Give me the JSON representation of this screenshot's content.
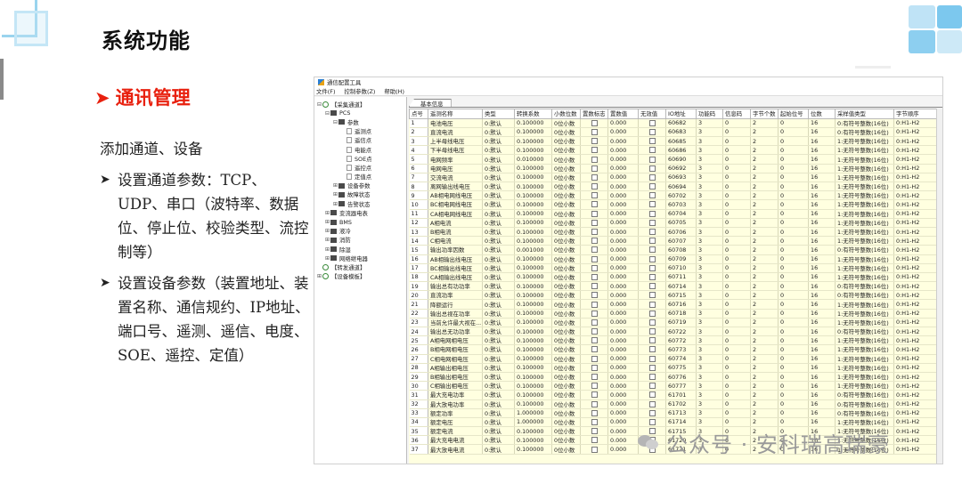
{
  "slide": {
    "title": "系统功能",
    "section_heading": "通讯管理",
    "intro": "添加通道、设备",
    "bullets": [
      "设置通道参数：TCP、UDP、串口（波特率、数据位、停止位、校验类型、流控制等）",
      "设置设备参数（装置地址、装置名称、通信规约、IP地址、端口号、遥测、遥信、电度、SOE、遥控、定值）"
    ],
    "watermark": "公众号 · 安科瑞高瑞豪"
  },
  "app": {
    "title": "通信配置工具",
    "menu": [
      "文件(F)",
      "控制参数(Z)",
      "帮助(H)"
    ],
    "tab_label": "基本信息",
    "tree": [
      {
        "label": "【采集通道】",
        "depth": 0,
        "toggle": "⊟",
        "icon": "gear"
      },
      {
        "label": "PCS",
        "depth": 1,
        "toggle": "⊟",
        "icon": "folder"
      },
      {
        "label": "参数",
        "depth": 2,
        "toggle": "⊟",
        "icon": "folder"
      },
      {
        "label": "遥测点",
        "depth": 3,
        "toggle": "",
        "icon": "leaf"
      },
      {
        "label": "遥信点",
        "depth": 3,
        "toggle": "",
        "icon": "leaf"
      },
      {
        "label": "电能点",
        "depth": 3,
        "toggle": "",
        "icon": "leaf"
      },
      {
        "label": "SOE点",
        "depth": 3,
        "toggle": "",
        "icon": "leaf"
      },
      {
        "label": "遥控点",
        "depth": 3,
        "toggle": "",
        "icon": "leaf"
      },
      {
        "label": "定值点",
        "depth": 3,
        "toggle": "",
        "icon": "leaf"
      },
      {
        "label": "设备参数",
        "depth": 2,
        "toggle": "⊞",
        "icon": "folder"
      },
      {
        "label": "故障状态",
        "depth": 2,
        "toggle": "⊞",
        "icon": "folder"
      },
      {
        "label": "告警状态",
        "depth": 2,
        "toggle": "⊞",
        "icon": "folder"
      },
      {
        "label": "变流器电表",
        "depth": 1,
        "toggle": "⊞",
        "icon": "folder"
      },
      {
        "label": "BMS",
        "depth": 1,
        "toggle": "⊞",
        "icon": "folder"
      },
      {
        "label": "液冷",
        "depth": 1,
        "toggle": "⊞",
        "icon": "folder"
      },
      {
        "label": "消防",
        "depth": 1,
        "toggle": "⊞",
        "icon": "folder"
      },
      {
        "label": "除湿",
        "depth": 1,
        "toggle": "⊞",
        "icon": "folder"
      },
      {
        "label": "网络继电器",
        "depth": 1,
        "toggle": "⊞",
        "icon": "folder"
      },
      {
        "label": "【转发通道】",
        "depth": 0,
        "toggle": "",
        "icon": "gear"
      },
      {
        "label": "【设备模板】",
        "depth": 0,
        "toggle": "⊞",
        "icon": "gear"
      }
    ],
    "columns": [
      "点号",
      "遥测名称",
      "类型",
      "转换系数",
      "小数位数",
      "置数标志",
      "置数值",
      "无效值",
      "IO地址",
      "功能码",
      "信息码",
      "字节个数",
      "起始位号",
      "位数",
      "采样值类型",
      "字节顺序"
    ],
    "rows": [
      [
        "1",
        "电池电压",
        "0:默认",
        "0.100000",
        "0位小数",
        "",
        "0.000",
        "",
        "60682",
        "3",
        "0",
        "2",
        "0",
        "16",
        "0:有符号整数(16位)",
        "0:H1-H2"
      ],
      [
        "2",
        "直流电流",
        "0:默认",
        "0.100000",
        "0位小数",
        "",
        "0.000",
        "",
        "60683",
        "3",
        "0",
        "2",
        "0",
        "16",
        "0:有符号整数(16位)",
        "0:H1-H2"
      ],
      [
        "3",
        "上半母线电压",
        "0:默认",
        "0.100000",
        "0位小数",
        "",
        "0.000",
        "",
        "60685",
        "3",
        "0",
        "2",
        "0",
        "16",
        "1:无符号整数(16位)",
        "0:H1-H2"
      ],
      [
        "4",
        "下半母线电压",
        "0:默认",
        "0.100000",
        "0位小数",
        "",
        "0.000",
        "",
        "60686",
        "3",
        "0",
        "2",
        "0",
        "16",
        "1:无符号整数(16位)",
        "0:H1-H2"
      ],
      [
        "5",
        "电网频率",
        "0:默认",
        "0.010000",
        "0位小数",
        "",
        "0.000",
        "",
        "60690",
        "3",
        "0",
        "2",
        "0",
        "16",
        "1:无符号整数(16位)",
        "0:H1-H2"
      ],
      [
        "6",
        "电网电压",
        "0:默认",
        "0.100000",
        "0位小数",
        "",
        "0.000",
        "",
        "60692",
        "3",
        "0",
        "2",
        "0",
        "16",
        "1:无符号整数(16位)",
        "0:H1-H2"
      ],
      [
        "7",
        "交流电流",
        "0:默认",
        "0.100000",
        "0位小数",
        "",
        "0.000",
        "",
        "60693",
        "3",
        "0",
        "2",
        "0",
        "16",
        "1:无符号整数(16位)",
        "0:H1-H2"
      ],
      [
        "8",
        "离网输出线电压",
        "0:默认",
        "0.100000",
        "0位小数",
        "",
        "0.000",
        "",
        "60694",
        "3",
        "0",
        "2",
        "0",
        "16",
        "1:无符号整数(16位)",
        "0:H1-H2"
      ],
      [
        "9",
        "AB相电网线电压",
        "0:默认",
        "0.100000",
        "0位小数",
        "",
        "0.000",
        "",
        "60702",
        "3",
        "0",
        "2",
        "0",
        "16",
        "1:无符号整数(16位)",
        "0:H1-H2"
      ],
      [
        "10",
        "BC相电网线电压",
        "0:默认",
        "0.100000",
        "0位小数",
        "",
        "0.000",
        "",
        "60703",
        "3",
        "0",
        "2",
        "0",
        "16",
        "1:无符号整数(16位)",
        "0:H1-H2"
      ],
      [
        "11",
        "CA相电网线电压",
        "0:默认",
        "0.100000",
        "0位小数",
        "",
        "0.000",
        "",
        "60704",
        "3",
        "0",
        "2",
        "0",
        "16",
        "1:无符号整数(16位)",
        "0:H1-H2"
      ],
      [
        "12",
        "A相电流",
        "0:默认",
        "0.100000",
        "0位小数",
        "",
        "0.000",
        "",
        "60705",
        "3",
        "0",
        "2",
        "0",
        "16",
        "1:无符号整数(16位)",
        "0:H1-H2"
      ],
      [
        "13",
        "B相电流",
        "0:默认",
        "0.100000",
        "0位小数",
        "",
        "0.000",
        "",
        "60706",
        "3",
        "0",
        "2",
        "0",
        "16",
        "1:无符号整数(16位)",
        "0:H1-H2"
      ],
      [
        "14",
        "C相电流",
        "0:默认",
        "0.100000",
        "0位小数",
        "",
        "0.000",
        "",
        "60707",
        "3",
        "0",
        "2",
        "0",
        "16",
        "1:无符号整数(16位)",
        "0:H1-H2"
      ],
      [
        "15",
        "输出功率因数",
        "0:默认",
        "0.001000",
        "0位小数",
        "",
        "0.000",
        "",
        "60708",
        "3",
        "0",
        "2",
        "0",
        "16",
        "0:有符号整数(16位)",
        "0:H1-H2"
      ],
      [
        "16",
        "AB相输出线电压",
        "0:默认",
        "0.100000",
        "0位小数",
        "",
        "0.000",
        "",
        "60709",
        "3",
        "0",
        "2",
        "0",
        "16",
        "1:无符号整数(16位)",
        "0:H1-H2"
      ],
      [
        "17",
        "BC相输出线电压",
        "0:默认",
        "0.100000",
        "0位小数",
        "",
        "0.000",
        "",
        "60710",
        "3",
        "0",
        "2",
        "0",
        "16",
        "1:无符号整数(16位)",
        "0:H1-H2"
      ],
      [
        "18",
        "CA相输出线电压",
        "0:默认",
        "0.100000",
        "0位小数",
        "",
        "0.000",
        "",
        "60711",
        "3",
        "0",
        "2",
        "0",
        "16",
        "1:无符号整数(16位)",
        "0:H1-H2"
      ],
      [
        "19",
        "输出总有功功率",
        "0:默认",
        "0.100000",
        "0位小数",
        "",
        "0.000",
        "",
        "60714",
        "3",
        "0",
        "2",
        "0",
        "16",
        "0:有符号整数(16位)",
        "0:H1-H2"
      ],
      [
        "20",
        "直流功率",
        "0:默认",
        "0.100000",
        "0位小数",
        "",
        "0.000",
        "",
        "60715",
        "3",
        "0",
        "2",
        "0",
        "16",
        "0:有符号整数(16位)",
        "0:H1-H2"
      ],
      [
        "21",
        "降额运行",
        "0:默认",
        "0.100000",
        "0位小数",
        "",
        "0.000",
        "",
        "60716",
        "3",
        "0",
        "2",
        "0",
        "16",
        "1:无符号整数(16位)",
        "0:H1-H2"
      ],
      [
        "22",
        "输出总视在功率",
        "0:默认",
        "0.100000",
        "0位小数",
        "",
        "0.000",
        "",
        "60718",
        "3",
        "0",
        "2",
        "0",
        "16",
        "1:无符号整数(16位)",
        "0:H1-H2"
      ],
      [
        "23",
        "当前允许最大视在...",
        "0:默认",
        "0.100000",
        "0位小数",
        "",
        "0.000",
        "",
        "60719",
        "3",
        "0",
        "2",
        "0",
        "16",
        "1:无符号整数(16位)",
        "0:H1-H2"
      ],
      [
        "24",
        "输出总无功功率",
        "0:默认",
        "0.100000",
        "0位小数",
        "",
        "0.000",
        "",
        "60722",
        "3",
        "0",
        "2",
        "0",
        "16",
        "0:有符号整数(16位)",
        "0:H1-H2"
      ],
      [
        "25",
        "A相电网相电压",
        "0:默认",
        "0.100000",
        "0位小数",
        "",
        "0.000",
        "",
        "60772",
        "3",
        "0",
        "2",
        "0",
        "16",
        "1:无符号整数(16位)",
        "0:H1-H2"
      ],
      [
        "26",
        "B相电网相电压",
        "0:默认",
        "0.100000",
        "0位小数",
        "",
        "0.000",
        "",
        "60773",
        "3",
        "0",
        "2",
        "0",
        "16",
        "1:无符号整数(16位)",
        "0:H1-H2"
      ],
      [
        "27",
        "C相电网相电压",
        "0:默认",
        "0.100000",
        "0位小数",
        "",
        "0.000",
        "",
        "60774",
        "3",
        "0",
        "2",
        "0",
        "16",
        "1:无符号整数(16位)",
        "0:H1-H2"
      ],
      [
        "28",
        "A相输出相电压",
        "0:默认",
        "0.100000",
        "0位小数",
        "",
        "0.000",
        "",
        "60775",
        "3",
        "0",
        "2",
        "0",
        "16",
        "1:无符号整数(16位)",
        "0:H1-H2"
      ],
      [
        "29",
        "B相输出相电压",
        "0:默认",
        "0.100000",
        "0位小数",
        "",
        "0.000",
        "",
        "60776",
        "3",
        "0",
        "2",
        "0",
        "16",
        "1:无符号整数(16位)",
        "0:H1-H2"
      ],
      [
        "30",
        "C相输出相电压",
        "0:默认",
        "0.100000",
        "0位小数",
        "",
        "0.000",
        "",
        "60777",
        "3",
        "0",
        "2",
        "0",
        "16",
        "1:无符号整数(16位)",
        "0:H1-H2"
      ],
      [
        "31",
        "最大充电功率",
        "0:默认",
        "0.100000",
        "0位小数",
        "",
        "0.000",
        "",
        "61701",
        "3",
        "0",
        "2",
        "0",
        "16",
        "0:有符号整数(16位)",
        "0:H1-H2"
      ],
      [
        "32",
        "最大放电功率",
        "0:默认",
        "0.100000",
        "0位小数",
        "",
        "0.000",
        "",
        "61702",
        "3",
        "0",
        "2",
        "0",
        "16",
        "0:有符号整数(16位)",
        "0:H1-H2"
      ],
      [
        "33",
        "额定功率",
        "0:默认",
        "1.000000",
        "0位小数",
        "",
        "0.000",
        "",
        "61713",
        "3",
        "0",
        "2",
        "0",
        "16",
        "0:有符号整数(16位)",
        "0:H1-H2"
      ],
      [
        "34",
        "额定电压",
        "0:默认",
        "1.000000",
        "0位小数",
        "",
        "0.000",
        "",
        "61714",
        "3",
        "0",
        "2",
        "0",
        "16",
        "1:无符号整数(16位)",
        "0:H1-H2"
      ],
      [
        "35",
        "额定电流",
        "0:默认",
        "0.100000",
        "0位小数",
        "",
        "0.000",
        "",
        "61715",
        "3",
        "0",
        "2",
        "0",
        "16",
        "1:无符号整数(16位)",
        "0:H1-H2"
      ],
      [
        "36",
        "最大充电电流",
        "0:默认",
        "0.100000",
        "0位小数",
        "",
        "0.000",
        "",
        "61720",
        "3",
        "0",
        "2",
        "0",
        "16",
        "1:无符号整数(16位)",
        "0:H1-H2"
      ],
      [
        "37",
        "最大放电电流",
        "0:默认",
        "0.100000",
        "0位小数",
        "",
        "0.000",
        "",
        "61721",
        "3",
        "0",
        "2",
        "0",
        "16",
        "1:无符号整数(16位)",
        "0:H1-H2"
      ]
    ]
  },
  "colors": {
    "accent_red": "#e8200e",
    "grid_cell_bg": "#ffffe0",
    "deco_blue": "#9ad4ee"
  }
}
